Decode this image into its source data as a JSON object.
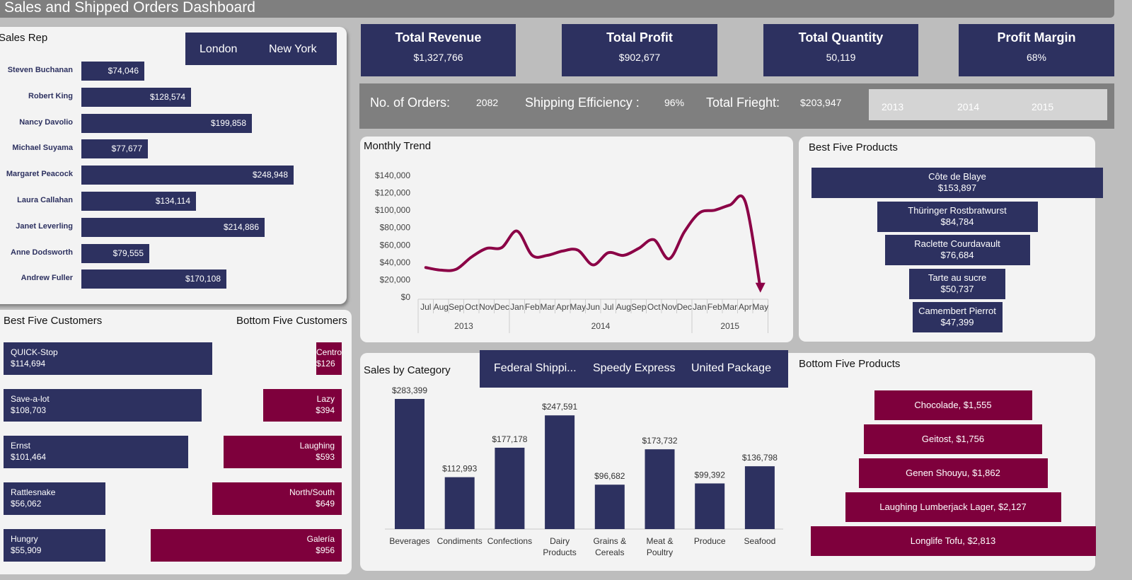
{
  "header": {
    "title": "Sales and Shipped Orders Dashboard"
  },
  "colors": {
    "navy": "#2d3160",
    "maroon": "#7e003c",
    "trend": "#8b0046"
  },
  "sales_rep": {
    "title": "Sales Rep",
    "slicer": [
      "London",
      "New York"
    ],
    "reps": [
      {
        "name": "Steven Buchanan",
        "value": "$74,046",
        "amount": 74046
      },
      {
        "name": "Robert King",
        "value": "$128,574",
        "amount": 128574
      },
      {
        "name": "Nancy Davolio",
        "value": "$199,858",
        "amount": 199858
      },
      {
        "name": "Michael Suyama",
        "value": "$77,677",
        "amount": 77677
      },
      {
        "name": "Margaret Peacock",
        "value": "$248,948",
        "amount": 248948
      },
      {
        "name": "Laura Callahan",
        "value": "$134,114",
        "amount": 134114
      },
      {
        "name": "Janet Leverling",
        "value": "$214,886",
        "amount": 214886
      },
      {
        "name": "Anne Dodsworth",
        "value": "$79,555",
        "amount": 79555
      },
      {
        "name": "Andrew Fuller",
        "value": "$170,108",
        "amount": 170108
      }
    ]
  },
  "kpis": [
    {
      "title": "Total Revenue",
      "value": "$1,327,766"
    },
    {
      "title": "Total Profit",
      "value": "$902,677"
    },
    {
      "title": "Total Quantity",
      "value": "50,119"
    },
    {
      "title": "Profit Margin",
      "value": "68%"
    }
  ],
  "info": {
    "orders_label": "No. of Orders:",
    "orders_value": "2082",
    "efficiency_label": "Shipping Efficiency :",
    "efficiency_value": "96%",
    "freight_label": "Total Frieght:",
    "freight_value": "$203,947",
    "years": [
      "2013",
      "2014",
      "2015"
    ]
  },
  "monthly_trend": {
    "title": "Monthly Trend",
    "y_ticks": [
      "$140,000",
      "$120,000",
      "$100,000",
      "$80,000",
      "$60,000",
      "$40,000",
      "$20,000",
      "$0"
    ],
    "months": [
      "Jul",
      "Aug",
      "Sep",
      "Oct",
      "Nov",
      "Dec",
      "Jan",
      "Feb",
      "Mar",
      "Apr",
      "May",
      "Jun",
      "Jul",
      "Aug",
      "Sep",
      "Oct",
      "Nov",
      "Dec",
      "Jan",
      "Feb",
      "Mar",
      "Apr",
      "May"
    ],
    "years": [
      "2013",
      "2014",
      "2015"
    ]
  },
  "best_products": {
    "title": "Best Five Products",
    "items": [
      {
        "name": "Côte de Blaye",
        "value": "$153,897",
        "amount": 153897
      },
      {
        "name": "Thüringer Rostbratwurst",
        "value": "$84,784",
        "amount": 84784
      },
      {
        "name": "Raclette Courdavault",
        "value": "$76,684",
        "amount": 76684
      },
      {
        "name": "Tarte au sucre",
        "value": "$50,737",
        "amount": 50737
      },
      {
        "name": "Camembert Pierrot",
        "value": "$47,399",
        "amount": 47399
      }
    ]
  },
  "best_customers": {
    "title": "Best Five Customers",
    "items": [
      {
        "name": "QUICK-Stop",
        "value": "$114,694",
        "amount": 114694
      },
      {
        "name": "Save-a-lot",
        "value": "$108,703",
        "amount": 108703
      },
      {
        "name": "Ernst",
        "value": "$101,464",
        "amount": 101464
      },
      {
        "name": "Rattlesnake",
        "value": "$56,062",
        "amount": 56062
      },
      {
        "name": "Hungry",
        "value": "$55,909",
        "amount": 55909
      }
    ]
  },
  "bottom_customers": {
    "title": "Bottom Five Customers",
    "items": [
      {
        "name": "Centro",
        "value": "$126",
        "amount": 126
      },
      {
        "name": "Lazy",
        "value": "$394",
        "amount": 394
      },
      {
        "name": "Laughing",
        "value": "$593",
        "amount": 593
      },
      {
        "name": "North/South",
        "value": "$649",
        "amount": 649
      },
      {
        "name": "Galería",
        "value": "$956",
        "amount": 956
      }
    ]
  },
  "sales_by_category": {
    "title": "Sales by Category",
    "shippers": [
      "Federal Shippi...",
      "Speedy Express",
      "United Package"
    ]
  },
  "bottom_products": {
    "title": "Bottom Five Products",
    "items": [
      {
        "label": "Chocolade, $1,555",
        "amount": 1555
      },
      {
        "label": "Geitost, $1,756",
        "amount": 1756
      },
      {
        "label": "Genen Shouyu, $1,862",
        "amount": 1862
      },
      {
        "label": "Laughing Lumberjack Lager, $2,127",
        "amount": 2127
      },
      {
        "label": "Longlife Tofu, $2,813",
        "amount": 2813
      }
    ]
  },
  "chart_data": [
    {
      "type": "bar",
      "title": "Sales by Category",
      "categories": [
        "Beverages",
        "Condiments",
        "Confections",
        "Dairy Products",
        "Grains & Cereals",
        "Meat & Poultry",
        "Produce",
        "Seafood"
      ],
      "values": [
        283399,
        112993,
        177178,
        247591,
        96682,
        173732,
        99392,
        136798
      ],
      "labels": [
        "$283,399",
        "$112,993",
        "$177,178",
        "$247,591",
        "$96,682",
        "$173,732",
        "$99,392",
        "$136,798"
      ],
      "ylim": [
        0,
        300000
      ]
    },
    {
      "type": "line",
      "title": "Monthly Trend",
      "x": [
        "Jul 2013",
        "Aug 2013",
        "Sep 2013",
        "Oct 2013",
        "Nov 2013",
        "Dec 2013",
        "Jan 2014",
        "Feb 2014",
        "Mar 2014",
        "Apr 2014",
        "May 2014",
        "Jun 2014",
        "Jul 2014",
        "Aug 2014",
        "Sep 2014",
        "Oct 2014",
        "Nov 2014",
        "Dec 2014",
        "Jan 2015",
        "Feb 2015",
        "Mar 2015",
        "Apr 2015",
        "May 2015"
      ],
      "values": [
        34000,
        31000,
        32000,
        46000,
        56000,
        57000,
        76000,
        48000,
        48000,
        53000,
        54000,
        37000,
        51000,
        48000,
        56000,
        66000,
        44000,
        75000,
        97000,
        100000,
        106000,
        110000,
        10000
      ],
      "ylim": [
        0,
        140000
      ],
      "grid": false
    }
  ]
}
